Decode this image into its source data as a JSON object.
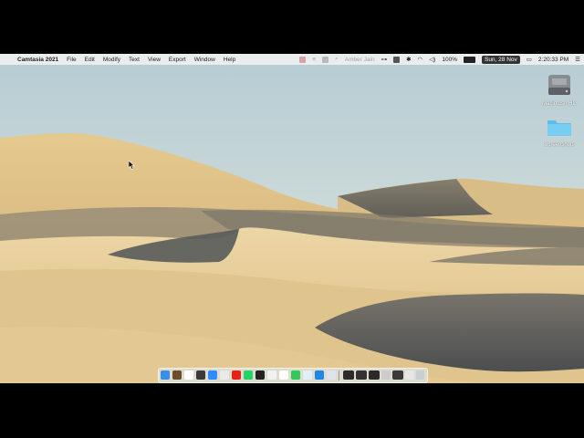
{
  "menubar": {
    "apple_glyph": "",
    "app_name": "Camtasia 2021",
    "menus": [
      "File",
      "Edit",
      "Modify",
      "Text",
      "View",
      "Export",
      "Window",
      "Help"
    ],
    "user_name": "Amber Jain",
    "battery": "100%",
    "date": "Sun, 28 Nov",
    "time": "2:20:33 PM"
  },
  "desktop": {
    "icons": [
      {
        "label": "Macintosh HD",
        "icon": "hard-drive-icon"
      },
      {
        "label": "Screenshots",
        "icon": "folder-icon"
      }
    ]
  },
  "dock": {
    "apps": [
      {
        "name": "finder",
        "color": "#3a8ee6"
      },
      {
        "name": "camtasia",
        "color": "#6b4e2a"
      },
      {
        "name": "calendar",
        "color": "#ffffff"
      },
      {
        "name": "photo-booth",
        "color": "#3b3b3b"
      },
      {
        "name": "zoom",
        "color": "#2d8cff"
      },
      {
        "name": "chrome",
        "color": "#e9e9e9"
      },
      {
        "name": "youtube",
        "color": "#e62117"
      },
      {
        "name": "whatsapp",
        "color": "#25d366"
      },
      {
        "name": "terminal",
        "color": "#222222"
      },
      {
        "name": "notes",
        "color": "#f1f1f1"
      },
      {
        "name": "notion",
        "color": "#ffffff"
      },
      {
        "name": "facetime",
        "color": "#34c759"
      },
      {
        "name": "preview",
        "color": "#e4eef8"
      },
      {
        "name": "safari",
        "color": "#1e88e5"
      },
      {
        "name": "xcode",
        "color": "#dfe4ea"
      }
    ],
    "windows": [
      {
        "name": "minimized-window-1",
        "color": "#2b2b2b"
      },
      {
        "name": "minimized-window-2",
        "color": "#333333"
      },
      {
        "name": "minimized-window-3",
        "color": "#2a2a2a"
      },
      {
        "name": "minimized-window-4",
        "color": "#cccccc"
      },
      {
        "name": "minimized-window-5",
        "color": "#3a3a3a"
      },
      {
        "name": "minimized-window-6",
        "color": "#e6e6e6"
      },
      {
        "name": "trash",
        "color": "#c8ced2"
      }
    ]
  },
  "colors": {
    "sky_top": "#b9d0d8",
    "sky_bottom": "#dfe6dc",
    "sand_light": "#e7cf9a",
    "sand_mid": "#d4b57a",
    "shadow": "#5d5f5f"
  }
}
